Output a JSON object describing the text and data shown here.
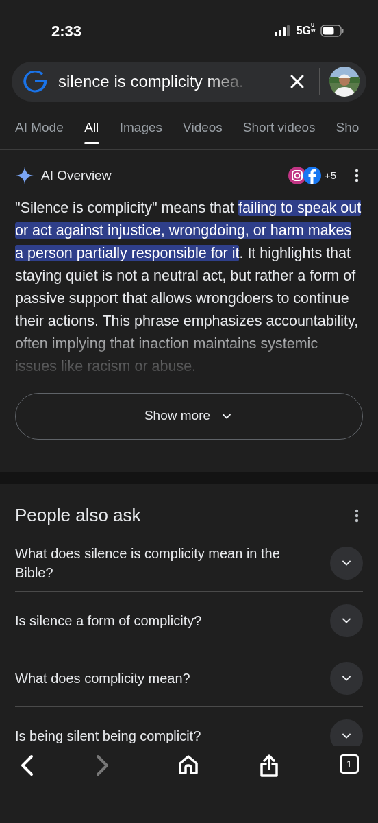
{
  "status_bar": {
    "time": "2:33",
    "network": "5G",
    "network_sub": "UW"
  },
  "search": {
    "query": "silence is complicity mea."
  },
  "tabs": [
    {
      "label": "AI Mode",
      "selected": false
    },
    {
      "label": "All",
      "selected": true
    },
    {
      "label": "Images",
      "selected": false
    },
    {
      "label": "Videos",
      "selected": false
    },
    {
      "label": "Short videos",
      "selected": false
    },
    {
      "label": "Sho",
      "selected": false
    }
  ],
  "ai_overview": {
    "title": "AI Overview",
    "sources_more": "+5",
    "text_before": "\"Silence is complicity\" means that ",
    "text_highlight": "failing to speak out or act against injustice, wrongdoing, or harm makes a person partially responsible for it",
    "text_after": ". It highlights that staying quiet is not a neutral act, but rather a form of passive support that allows wrongdoers to continue their actions. This phrase emphasizes accountability, often implying that inaction maintains systemic issues like racism or abuse.",
    "show_more": "Show more"
  },
  "people_also_ask": {
    "title": "People also ask",
    "questions": [
      {
        "text": "What does silence is complicity mean in the Bible?",
        "expanded": false
      },
      {
        "text": "Is silence a form of complicity?",
        "expanded": false
      },
      {
        "text": "What does complicity mean?",
        "expanded": false
      },
      {
        "text": "Is being silent being complicit?",
        "expanded": false
      }
    ]
  },
  "bottom_bar": {
    "back_disabled": false,
    "forward_disabled": true,
    "tab_count": "1"
  }
}
